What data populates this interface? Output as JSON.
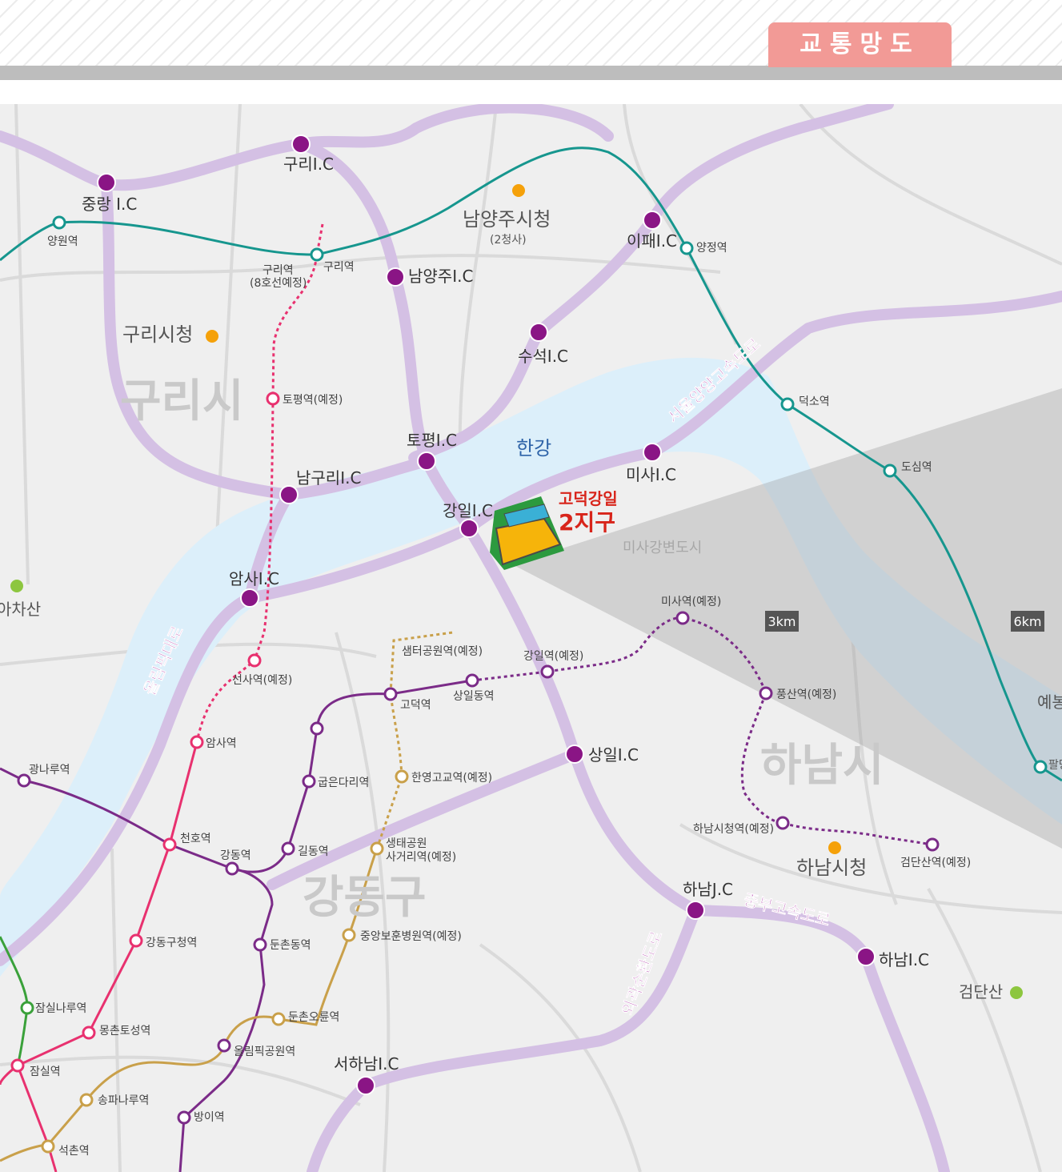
{
  "header": {
    "title": "교통망도"
  },
  "map": {
    "areas": {
      "guri_si": "구리시",
      "hanam_si": "하남시",
      "gangdong_gu": "강동구"
    },
    "river": "한강",
    "project": {
      "line1": "고덕강일",
      "line2": "2지구"
    },
    "new_town": "미사강변도시",
    "radius": [
      "3km",
      "6km"
    ],
    "landmarks": {
      "namyangju_hall": "남양주시청",
      "namyangju_hall_sub": "(2청사)",
      "guri_hall": "구리시청",
      "hanam_hall": "하남시청",
      "achasan": "아차산",
      "geomdansan": "검단산",
      "yebong": "예봉",
      "paldang": "팔당"
    },
    "highways": {
      "seoul_yangyang": "서울양양고속도로",
      "olympic": "올림픽대로",
      "jungbu": "중부고속도로",
      "outer_ring": "외곽순환도로"
    },
    "interchanges": {
      "jungrang": "중랑 I.C",
      "guri": "구리I.C",
      "namyangju": "남양주I.C",
      "ipae": "이패I.C",
      "suseok": "수석I.C",
      "topyeong": "토평I.C",
      "namguri": "남구리I.C",
      "gangil": "강일I.C",
      "misa": "미사I.C",
      "amsa": "암사I.C",
      "sangil": "상일I.C",
      "hanam_jc": "하남J.C",
      "hanam_ic": "하남I.C",
      "seohanam": "서하남I.C"
    },
    "stations": {
      "yangwon": "양원역",
      "guri_planned": "구리역",
      "guri_planned_sub": "(8호선예정)",
      "guri": "구리역",
      "yangjeong": "양정역",
      "toppyeong_planned": "토평역(예정)",
      "deokso": "덕소역",
      "dosim": "도심역",
      "misa_planned": "미사역(예정)",
      "seonsa_planned": "선사역(예정)",
      "semteo_planned": "샘터공원역(예정)",
      "gangil_planned": "강일역(예정)",
      "godeok": "고덕역",
      "sangildong": "상일동역",
      "pungsan_planned": "풍산역(예정)",
      "amsa": "암사역",
      "gwangnaru": "광나루역",
      "gubeundari": "굽은다리역",
      "hanyeong_planned": "한영고교역(예정)",
      "cheonho": "천호역",
      "gangdong": "강동역",
      "gildong": "길동역",
      "saengtae_1": "생태공원",
      "saengtae_2": "사거리역(예정)",
      "hanam_hall_planned": "하남시청역(예정)",
      "geomdansan_planned": "검단산역(예정)",
      "gangdong_gu_office": "강동구청역",
      "dunchondong": "둔촌동역",
      "jungang_planned": "중앙보훈병원역(예정)",
      "jamsilnaru": "잠실나루역",
      "mongchon": "몽촌토성역",
      "dunchon_oryun": "둔촌오륜역",
      "olympic_park": "올림픽공원역",
      "jamsil": "잠실역",
      "songpanaru": "송파나루역",
      "bangi": "방이역",
      "seokchon": "석촌역"
    }
  },
  "colors": {
    "highway": "#d4c0e4",
    "ic_dot": "#8a1585",
    "river": "#dceffa",
    "jungang_line": "#16968e",
    "line5": "#7b2b88",
    "line8": "#e8316f",
    "line9": "#c9a04a",
    "line2": "#3aa13a",
    "highway_label": "#a72ba0",
    "project_red": "#d8241a",
    "landmark_orange": "#f5a10a",
    "mountain_green": "#8dc63f",
    "area_label": "#c9c9c9"
  }
}
